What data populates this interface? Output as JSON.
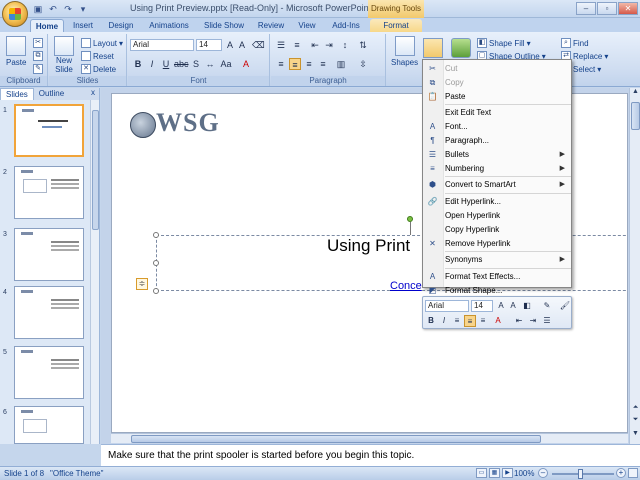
{
  "window": {
    "title": "Using Print Preview.pptx [Read-Only] - Microsoft PowerPoint",
    "contextual_tab": "Drawing Tools"
  },
  "tabs": [
    "Home",
    "Insert",
    "Design",
    "Animations",
    "Slide Show",
    "Review",
    "View",
    "Add-Ins",
    "Format"
  ],
  "ribbon": {
    "clipboard": {
      "paste": "Paste",
      "label": "Clipboard"
    },
    "slides": {
      "new_slide_line1": "New",
      "new_slide_line2": "Slide",
      "layout": "Layout",
      "reset": "Reset",
      "delete": "Delete",
      "label": "Slides"
    },
    "font": {
      "font_name": "Arial",
      "font_size": "14",
      "label": "Font"
    },
    "paragraph": {
      "label": "Paragraph"
    },
    "drawing": {
      "shapes": "Shapes",
      "shape_fill": "Shape Fill",
      "shape_outline": "Shape Outline",
      "label": "Drawing"
    },
    "editing": {
      "find": "Find",
      "replace": "Replace",
      "select": "Select"
    }
  },
  "left_pane": {
    "tabs": [
      "Slides",
      "Outline"
    ],
    "close": "x",
    "slide_numbers": [
      "1",
      "2",
      "3",
      "4",
      "5",
      "6"
    ]
  },
  "slide": {
    "logo": "WSG",
    "title": "Using Print",
    "link": "Conce"
  },
  "notes": "Make sure that the print spooler is started before you begin this topic.",
  "status": {
    "slide": "Slide 1 of 8",
    "theme": "\"Office Theme\"",
    "zoom": "100%"
  },
  "context_menu": [
    {
      "label": "Cut",
      "icon": "scissors-icon",
      "disabled": true
    },
    {
      "label": "Copy",
      "icon": "copy-icon",
      "disabled": true
    },
    {
      "label": "Paste",
      "icon": "paste-icon"
    },
    {
      "sep": true
    },
    {
      "label": "Exit Edit Text"
    },
    {
      "label": "Font...",
      "icon": "font-icon"
    },
    {
      "label": "Paragraph...",
      "icon": "paragraph-icon"
    },
    {
      "label": "Bullets",
      "icon": "bullets-icon",
      "submenu": true
    },
    {
      "label": "Numbering",
      "icon": "numbering-icon",
      "submenu": true
    },
    {
      "sep": true
    },
    {
      "label": "Convert to SmartArt",
      "icon": "smartart-icon",
      "submenu": true
    },
    {
      "sep": true
    },
    {
      "label": "Edit Hyperlink...",
      "icon": "hyperlink-icon"
    },
    {
      "label": "Open Hyperlink"
    },
    {
      "label": "Copy Hyperlink"
    },
    {
      "label": "Remove Hyperlink",
      "icon": "remove-link-icon"
    },
    {
      "sep": true
    },
    {
      "label": "Synonyms",
      "submenu": true
    },
    {
      "sep": true
    },
    {
      "label": "Format Text Effects...",
      "icon": "text-effects-icon"
    },
    {
      "label": "Format Shape...",
      "icon": "format-shape-icon"
    }
  ],
  "mini_toolbar": {
    "font_name": "Arial",
    "font_size": "14"
  }
}
